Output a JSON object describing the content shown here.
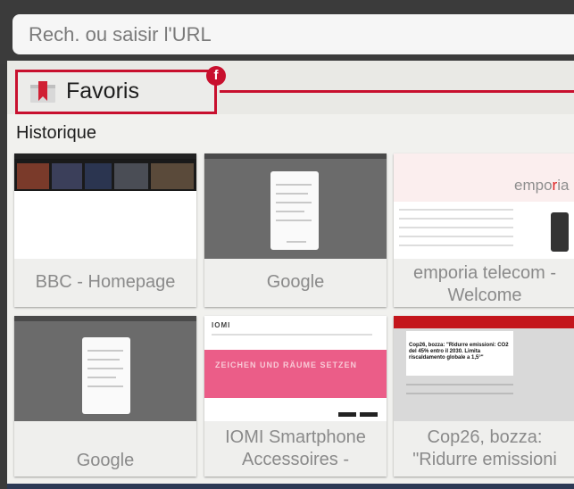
{
  "url_bar": {
    "placeholder": "Rech. ou saisir l'URL"
  },
  "favorites": {
    "label": "Favoris",
    "badge": "f"
  },
  "history": {
    "title": "Historique",
    "tiles": [
      {
        "title": "BBC - Homepage"
      },
      {
        "title": "Google"
      },
      {
        "title": "emporia telecom - Welcome"
      },
      {
        "title": "Google"
      },
      {
        "title": "IOMI Smartphone Accessoires -"
      },
      {
        "title": "Cop26, bozza: \"Ridurre emissioni"
      }
    ]
  },
  "thumb_text": {
    "emporia_logo_a": "empo",
    "emporia_logo_b": "r",
    "emporia_logo_c": "ia",
    "iomi_logo": "IOMI",
    "iomi_hero": "ZEICHEN UND RÄUME SETZEN",
    "cop_headline": "Cop26, bozza: \"Ridurre emissioni: CO2 del 45% entro il 2030. Limita riscaldamento globale a 1,5°\""
  },
  "colors": {
    "accent": "#c8102e"
  }
}
